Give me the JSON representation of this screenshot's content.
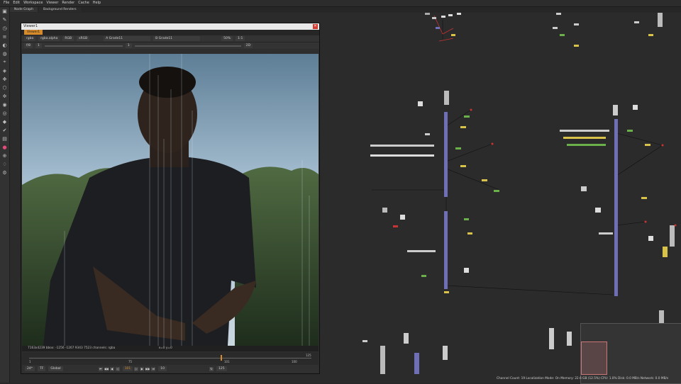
{
  "menu": [
    "File",
    "Edit",
    "Workspace",
    "Viewer",
    "Render",
    "Cache",
    "Help"
  ],
  "tabs": [
    "Node Graph",
    "Background Renders"
  ],
  "viewer": {
    "title": "Viewer1",
    "tab": "Viewer1",
    "row1": {
      "channel": "rgba",
      "alpha": "rgba.alpha",
      "colorspace": "RGB",
      "display": "sRGB",
      "input_a": "A  Grade11",
      "input_b": "B  Grade11",
      "zoom": "50%",
      "proxy": "1:1"
    },
    "row2": {
      "gain_label": "f/8",
      "gain_value": "1",
      "gamma_value": "1",
      "frame_value": "2D"
    },
    "info_text": "7163x4239  bbox: -1256 -1267 9343 7523 channels: rgba",
    "coords": "x=0 y=0",
    "timeline": {
      "start": "1",
      "end": "125",
      "mark_left": "75",
      "mark_mid": "100",
      "current": "101",
      "end2": "125"
    },
    "transport": {
      "fps": "24*",
      "tf": "TF",
      "global": "Global",
      "frame": "101",
      "increment": "10",
      "end_frame": "125"
    }
  },
  "status_text": "Channel Count: 19  Localization Mode: On  Memory: 22.6 GB (12.5%)  CPU: 1.0%  Disk: 0.0 MB/s  Network: 0.0 MB/s",
  "colors": {
    "accent": "#d58b2b",
    "close": "#d13a2f",
    "node_red": "#cc3333",
    "node_yellow": "#d8c24a",
    "node_green": "#6bb04a"
  },
  "icons": [
    "viewer-icon",
    "paint-icon",
    "clock-icon",
    "channel-icon",
    "color-icon",
    "filter-icon",
    "keyer-icon",
    "merge-icon",
    "transform-icon",
    "3d-icon",
    "particle-icon",
    "deep-icon",
    "views-icon",
    "metadata-icon",
    "toolsets-icon",
    "other-icon",
    "furnace-icon",
    "ocio-icon",
    "plugin-icon",
    "cara-icon"
  ]
}
